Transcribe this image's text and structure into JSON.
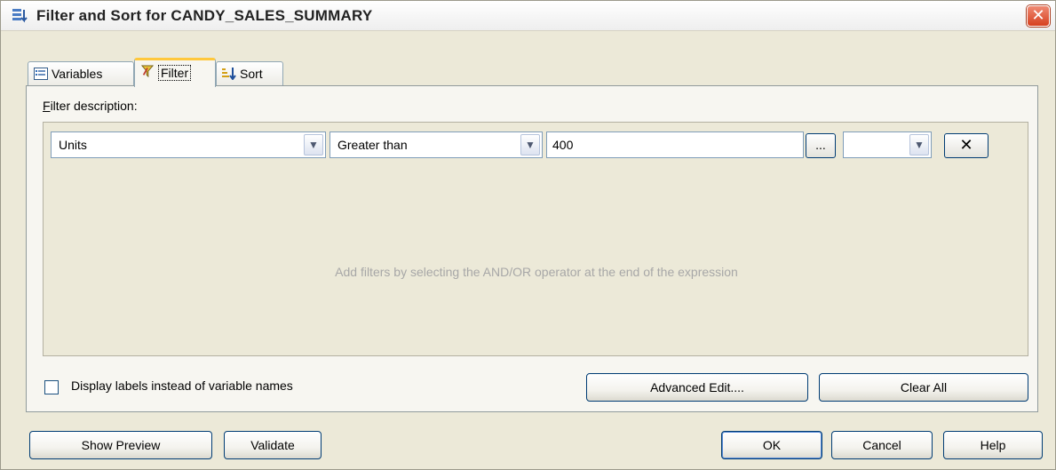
{
  "window": {
    "title": "Filter and Sort for CANDY_SALES_SUMMARY",
    "close_glyph": "✕"
  },
  "tabs": [
    {
      "label": "Variables",
      "icon": "variables-icon",
      "active": false
    },
    {
      "label": "Filter",
      "icon": "funnel-icon",
      "active": true
    },
    {
      "label": "Sort",
      "icon": "sort-icon",
      "active": false
    }
  ],
  "filter": {
    "description_label": "Filter description:",
    "variable": "Units",
    "operator": "Greater than",
    "value": "400",
    "browse_label": "...",
    "logic_operator": "",
    "remove_glyph": "✕",
    "hint": "Add filters by selecting the AND/OR operator at the end of the expression"
  },
  "options": {
    "display_labels_text": "Display labels instead of variable names",
    "display_labels_checked": false
  },
  "panel_buttons": {
    "advanced_edit": "Advanced Edit....",
    "clear_all": "Clear All"
  },
  "footer_buttons": {
    "show_preview": "Show Preview",
    "validate": "Validate",
    "ok": "OK",
    "cancel": "Cancel",
    "help": "Help"
  },
  "colors": {
    "dialog_bg": "#ece9d8",
    "accent_tab": "#ffc83c",
    "button_border": "#003c74",
    "close_red": "#d6401f"
  }
}
